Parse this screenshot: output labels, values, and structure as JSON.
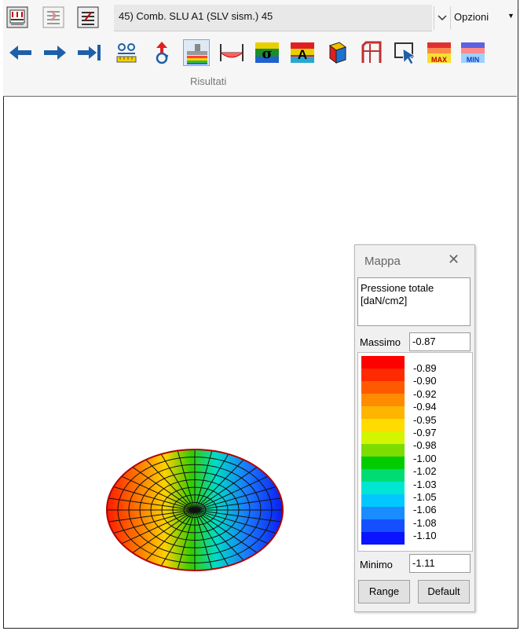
{
  "toolbar": {
    "combination_label": "45) Comb. SLU A1 (SLV sism.) 45",
    "options_label": "Opzioni",
    "group_label": "Risultati",
    "max_label": "MAX",
    "min_label": "MIN",
    "sigma_label": "σ",
    "a_label": "A"
  },
  "map_window": {
    "title": "Mappa",
    "quantity_line1": "Pressione totale",
    "quantity_line2": "[daN/cm2]",
    "max_label": "Massimo",
    "max_value": "-0.87",
    "min_label": "Minimo",
    "min_value": "-1.11",
    "range_button": "Range",
    "default_button": "Default",
    "legend_ticks": [
      "-0.89",
      "-0.90",
      "-0.92",
      "-0.94",
      "-0.95",
      "-0.97",
      "-0.98",
      "-1.00",
      "-1.02",
      "-1.03",
      "-1.05",
      "-1.06",
      "-1.08",
      "-1.10"
    ],
    "legend_colors": [
      "#ff0000",
      "#ff2a00",
      "#ff5a00",
      "#ff8c00",
      "#ffb400",
      "#ffdc00",
      "#d4f500",
      "#7ddc00",
      "#00cc00",
      "#00dc73",
      "#00e6d2",
      "#00c8ff",
      "#1a8cff",
      "#1450ff",
      "#0a14ff"
    ]
  }
}
